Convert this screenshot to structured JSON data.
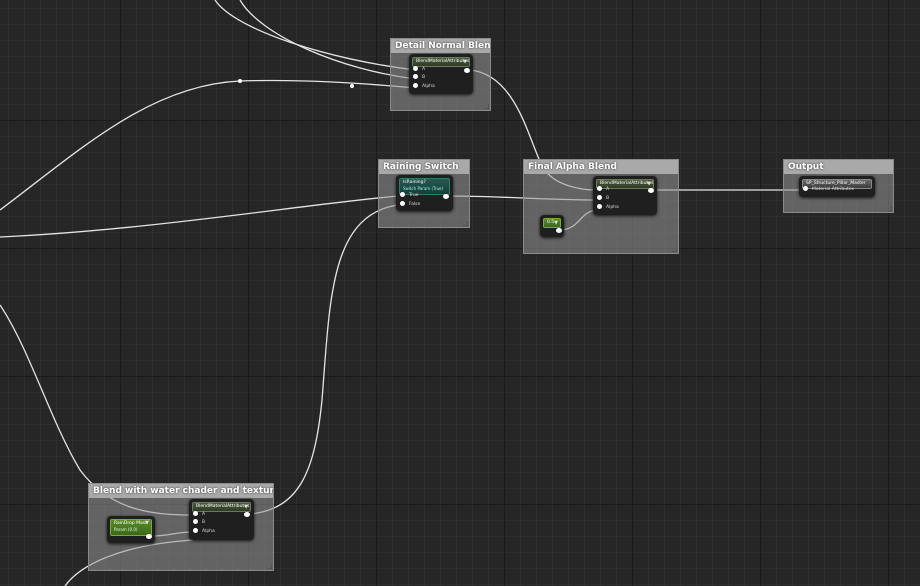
{
  "comments": {
    "detail_normal": "Detail Normal Blend",
    "raining_switch": "Raining Switch",
    "final_alpha": "Final Alpha Blend",
    "output": "Output",
    "water_blend": "Blend with water chader and textures"
  },
  "nodes": {
    "detail_blend": {
      "title": "BlendMaterialAttributes",
      "pins": [
        "A",
        "B",
        "Alpha"
      ]
    },
    "raining_switch": {
      "title": "IsRaining?",
      "subtitle": "Switch Param (True)",
      "pins": [
        "True",
        "False"
      ]
    },
    "final_blend": {
      "title": "BlendMaterialAttributes",
      "pins": [
        "A",
        "B",
        "Alpha"
      ]
    },
    "output": {
      "title": "SP_Structure_Pillar_Master",
      "pins": [
        "Material Attributes"
      ]
    },
    "const": {
      "value": "0.5"
    },
    "water_blend": {
      "title": "BlendMaterialAttributes",
      "pins": [
        "A",
        "B",
        "Alpha"
      ]
    },
    "raindrop_mask": {
      "title": "RainDrop Mask",
      "subtitle": "Param (0.0)"
    }
  },
  "colors": {
    "wire": "#e4e4e4",
    "comment_header": "#a9a9a9",
    "node_body": "#1f1f1f"
  }
}
